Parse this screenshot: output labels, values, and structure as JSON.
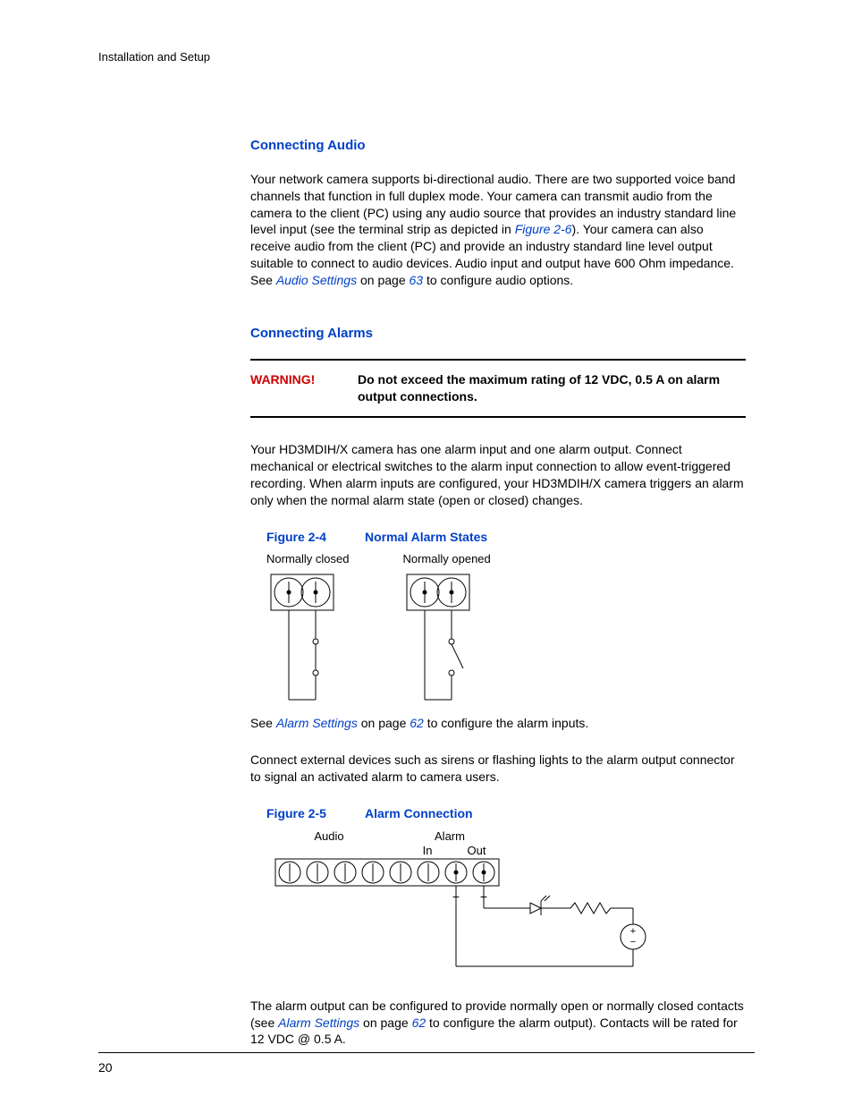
{
  "runningHead": "Installation and Setup",
  "pageNumber": "20",
  "sections": {
    "audio": {
      "title": "Connecting Audio",
      "para1a": "Your network camera supports bi-directional audio. There are two supported voice band channels that function in full duplex mode. Your camera can transmit audio from the camera to the client (PC) using any audio source that provides an industry standard line level input (see the terminal strip as depicted in ",
      "figref": "Figure 2-6",
      "para1b": "). Your camera can also receive audio from the client (PC) and provide an industry standard line level output suitable to connect to audio devices. Audio input and output have 600 Ohm impedance. See ",
      "settingsRef": "Audio Settings",
      "para1c": " on page ",
      "pageRef": "63",
      "para1d": " to configure audio options."
    },
    "alarms": {
      "title": "Connecting Alarms",
      "warningLabel": "WARNING!",
      "warningText": "Do not exceed the maximum rating of 12 VDC, 0.5 A on alarm output connections.",
      "para1": "Your HD3MDIH/X camera has one alarm input and one alarm output. Connect mechanical or electrical switches to the alarm input connection to allow event-triggered recording. When alarm inputs are configured, your HD3MDIH/X camera triggers an alarm only when the normal alarm state (open or closed) changes.",
      "fig24": {
        "num": "Figure 2-4",
        "title": "Normal Alarm States",
        "leftLabel": "Normally closed",
        "rightLabel": "Normally opened"
      },
      "para2a": "See ",
      "alarmRef1": "Alarm Settings",
      "para2b": " on page ",
      "pageRef1": "62",
      "para2c": " to configure the alarm inputs.",
      "para3": "Connect external devices such as sirens or flashing lights to the alarm output connector to signal an activated alarm to camera users.",
      "fig25": {
        "num": "Figure 2-5",
        "title": "Alarm Connection",
        "audio": "Audio",
        "alarm": "Alarm",
        "in": "In",
        "out": "Out",
        "plus": "+",
        "minus": "−"
      },
      "para4a": "The alarm output can be configured to provide normally open or normally closed contacts (see ",
      "alarmRef2": "Alarm Settings",
      "para4b": " on page ",
      "pageRef2": "62",
      "para4c": " to configure the alarm output). Contacts will be rated for 12 VDC @ 0.5 A."
    }
  }
}
